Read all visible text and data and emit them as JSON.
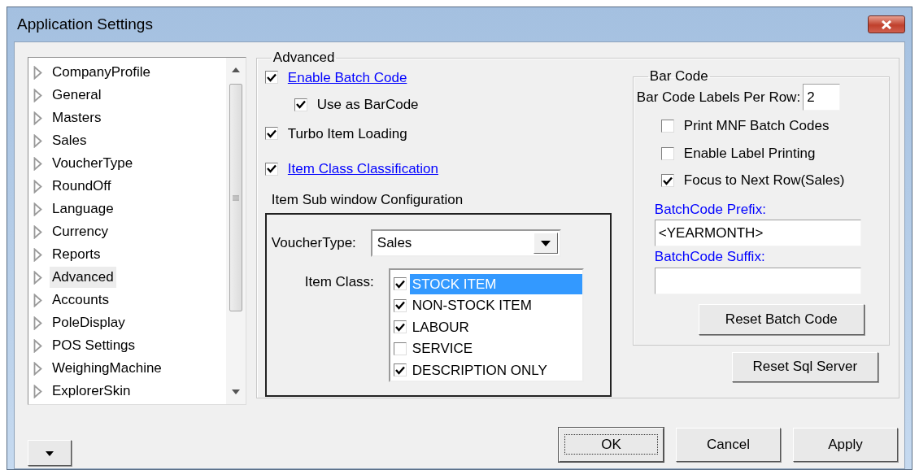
{
  "window": {
    "title": "Application Settings"
  },
  "sidebar": {
    "items": [
      {
        "label": "CompanyProfile",
        "selected": false
      },
      {
        "label": "General",
        "selected": false
      },
      {
        "label": "Masters",
        "selected": false
      },
      {
        "label": "Sales",
        "selected": false
      },
      {
        "label": "VoucherType",
        "selected": false
      },
      {
        "label": "RoundOff",
        "selected": false
      },
      {
        "label": "Language",
        "selected": false
      },
      {
        "label": "Currency",
        "selected": false
      },
      {
        "label": "Reports",
        "selected": false
      },
      {
        "label": "Advanced",
        "selected": true
      },
      {
        "label": "Accounts",
        "selected": false
      },
      {
        "label": "PoleDisplay",
        "selected": false
      },
      {
        "label": "POS Settings",
        "selected": false
      },
      {
        "label": "WeighingMachine",
        "selected": false
      },
      {
        "label": "ExplorerSkin",
        "selected": false
      }
    ]
  },
  "advanced": {
    "title": "Advanced",
    "options": [
      {
        "label": "Enable Batch Code",
        "checked": true,
        "kind": "link",
        "children": [
          {
            "label": "Use as BarCode",
            "checked": true,
            "kind": "plain"
          }
        ]
      },
      {
        "label": "Turbo Item Loading",
        "checked": true,
        "kind": "plain"
      },
      {
        "label": "Item Class Classification",
        "checked": true,
        "kind": "link"
      }
    ],
    "sub_window": {
      "title": "Item Sub window Configuration",
      "voucher_type": {
        "label": "VoucherType:",
        "value": "Sales"
      },
      "item_class": {
        "label": "Item Class:",
        "items": [
          {
            "label": "STOCK ITEM",
            "checked": true,
            "selected": true
          },
          {
            "label": "NON-STOCK ITEM",
            "checked": true,
            "selected": false
          },
          {
            "label": "LABOUR",
            "checked": true,
            "selected": false
          },
          {
            "label": "SERVICE",
            "checked": false,
            "selected": false
          },
          {
            "label": "DESCRIPTION ONLY",
            "checked": true,
            "selected": false
          }
        ]
      }
    },
    "bar_code": {
      "title": "Bar Code",
      "labels_per_row": {
        "label": "Bar Code Labels Per Row:",
        "value": "2"
      },
      "options": [
        {
          "label": "Print MNF Batch Codes",
          "checked": false
        },
        {
          "label": "Enable Label Printing",
          "checked": false
        },
        {
          "label": "Focus to Next Row(Sales)",
          "checked": true
        }
      ],
      "prefix": {
        "label": "BatchCode Prefix:",
        "value": "<YEARMONTH>"
      },
      "suffix": {
        "label": "BatchCode Suffix:"
      },
      "reset_button": "Reset Batch Code"
    },
    "reset_sql_button": "Reset Sql Server"
  },
  "buttons": [
    {
      "label": "OK",
      "default": true
    },
    {
      "label": "Cancel",
      "default": false
    },
    {
      "label": "Apply",
      "default": false
    }
  ]
}
